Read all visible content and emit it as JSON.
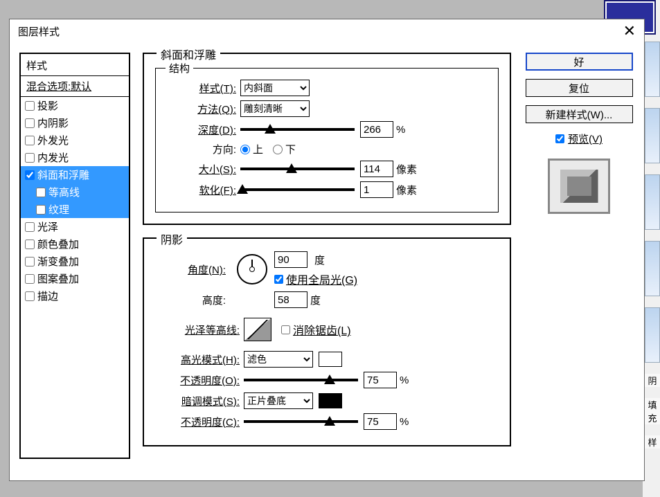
{
  "dialog": {
    "title": "图层样式"
  },
  "styles": {
    "header": "样式",
    "blend": "混合选项:默认",
    "items": [
      {
        "label": "投影",
        "checked": false,
        "selected": false,
        "sub": false
      },
      {
        "label": "内阴影",
        "checked": false,
        "selected": false,
        "sub": false
      },
      {
        "label": "外发光",
        "checked": false,
        "selected": false,
        "sub": false
      },
      {
        "label": "内发光",
        "checked": false,
        "selected": false,
        "sub": false
      },
      {
        "label": "斜面和浮雕",
        "checked": true,
        "selected": true,
        "sub": false
      },
      {
        "label": "等高线",
        "checked": false,
        "selected": true,
        "sub": true
      },
      {
        "label": "纹理",
        "checked": false,
        "selected": true,
        "sub": true
      },
      {
        "label": "光泽",
        "checked": false,
        "selected": false,
        "sub": false
      },
      {
        "label": "颜色叠加",
        "checked": false,
        "selected": false,
        "sub": false
      },
      {
        "label": "渐变叠加",
        "checked": false,
        "selected": false,
        "sub": false
      },
      {
        "label": "图案叠加",
        "checked": false,
        "selected": false,
        "sub": false
      },
      {
        "label": "描边",
        "checked": false,
        "selected": false,
        "sub": false
      }
    ]
  },
  "panel": {
    "title": "斜面和浮雕",
    "structure_title": "结构",
    "style_label": "样式(T):",
    "style_value": "内斜面",
    "method_label": "方法(Q):",
    "method_value": "雕刻清晰",
    "depth_label": "深度(D):",
    "depth_value": "266",
    "depth_unit": "%",
    "direction_label": "方向:",
    "direction_up": "上",
    "direction_down": "下",
    "size_label": "大小(S):",
    "size_value": "114",
    "size_unit": "像素",
    "soften_label": "软化(F):",
    "soften_value": "1",
    "soften_unit": "像素"
  },
  "shadow": {
    "title": "阴影",
    "angle_label": "角度(N):",
    "angle_value": "90",
    "angle_unit": "度",
    "global_label": "使用全局光(G)",
    "alt_label": "高度:",
    "alt_value": "58",
    "alt_unit": "度",
    "contour_label": "光泽等高线:",
    "antialias_label": "消除锯齿(L)",
    "hilite_mode_label": "高光模式(H):",
    "hilite_mode_value": "滤色",
    "hilite_opacity_label": "不透明度(O):",
    "hilite_opacity_value": "75",
    "hilite_opacity_unit": "%",
    "shadow_mode_label": "暗调模式(S):",
    "shadow_mode_value": "正片叠底",
    "shadow_opacity_label": "不透明度(C):",
    "shadow_opacity_value": "75",
    "shadow_opacity_unit": "%"
  },
  "buttons": {
    "ok": "好",
    "reset": "复位",
    "newstyle": "新建样式(W)...",
    "preview": "预览(V)"
  },
  "side": {
    "a": "阴",
    "b": "填充",
    "c": "样"
  }
}
